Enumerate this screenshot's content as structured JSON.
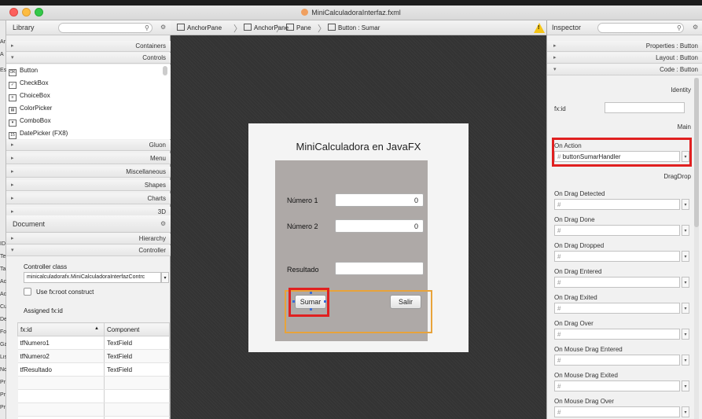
{
  "window": {
    "title": "MiniCalculadoraInterfaz.fxml"
  },
  "left_strip": [
    "Ar",
    "A",
    "Es",
    "ID",
    "Te",
    "Ta",
    "Ac",
    "Ac",
    "Cu",
    "De",
    "Fo",
    "Ga",
    "Lis",
    "No",
    "Pr",
    "Pr",
    "Pr"
  ],
  "library": {
    "title": "Library",
    "sections_top": [
      "Containers",
      "Controls"
    ],
    "items": [
      {
        "label": "Button",
        "icon": "ok-icon"
      },
      {
        "label": "CheckBox",
        "icon": "check-icon"
      },
      {
        "label": "ChoiceBox",
        "icon": "choicebox-icon"
      },
      {
        "label": "ColorPicker",
        "icon": "colorpicker-icon"
      },
      {
        "label": "ComboBox",
        "icon": "combobox-icon"
      },
      {
        "label": "DatePicker  (FX8)",
        "icon": "calendar-icon"
      }
    ],
    "sections_bottom": [
      "Gluon",
      "Menu",
      "Miscellaneous",
      "Shapes",
      "Charts",
      "3D"
    ]
  },
  "document": {
    "title": "Document",
    "sections": [
      "Hierarchy",
      "Controller"
    ],
    "controller_class_label": "Controller class",
    "controller_class_value": "minicalculadorafx.MiniCalculadoraInterfazContrc",
    "use_root_label": "Use fx:root construct",
    "assigned_label": "Assigned fx:id",
    "table_headers": [
      "fx:id",
      "Component"
    ],
    "table_rows": [
      {
        "fxid": "tfNumero1",
        "component": "TextField"
      },
      {
        "fxid": "tfNumero2",
        "component": "TextField"
      },
      {
        "fxid": "tfResultado",
        "component": "TextField"
      }
    ]
  },
  "breadcrumb": [
    "AnchorPane",
    "AnchorPane",
    "Pane",
    "Button : Sumar"
  ],
  "warning_symbol": "!",
  "scene": {
    "title": "MiniCalculadora en JavaFX",
    "label1": "Número 1",
    "value1": "0",
    "label2": "Número 2",
    "value2": "0",
    "label3": "Resultado",
    "value3": "",
    "btn_sumar": "Sumar",
    "btn_salir": "Salir"
  },
  "inspector": {
    "title": "Inspector",
    "sections": [
      {
        "label": "Properties : Button",
        "arrow": "▸"
      },
      {
        "label": "Layout : Button",
        "arrow": "▸"
      },
      {
        "label": "Code : Button",
        "arrow": "▾"
      }
    ],
    "identity_label": "Identity",
    "fxid_label": "fx:id",
    "main_label": "Main",
    "on_action_label": "On Action",
    "on_action_value": "buttonSumarHandler",
    "dragdrop_label": "DragDrop",
    "events": [
      "On Drag Detected",
      "On Drag Done",
      "On Drag Dropped",
      "On Drag Entered",
      "On Drag Exited",
      "On Drag Over",
      "On Mouse Drag Entered",
      "On Mouse Drag Exited",
      "On Mouse Drag Over"
    ],
    "hash": "#"
  },
  "colors": {
    "selection": "#e02020",
    "hbox_outline": "#e8a33a",
    "handle": "#3a6bd6"
  }
}
